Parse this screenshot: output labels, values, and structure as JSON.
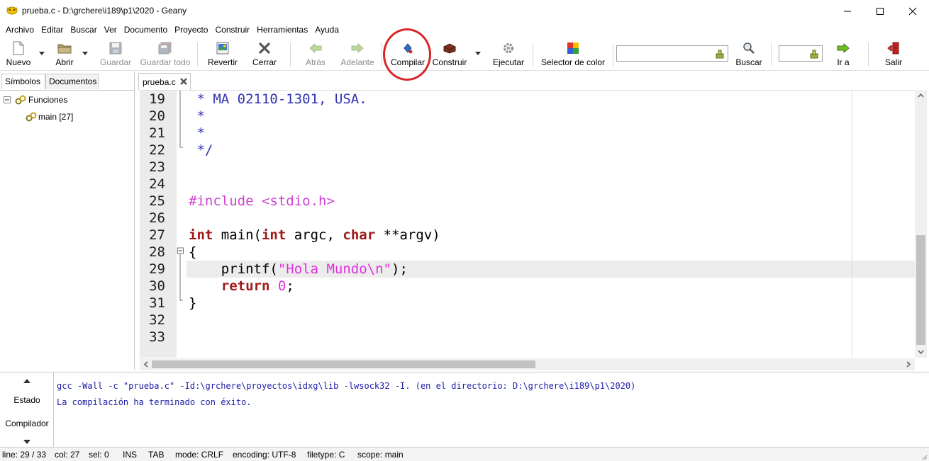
{
  "window": {
    "title": "prueba.c - D:\\grchere\\i189\\p1\\2020 - Geany",
    "icon": "geany-lamp-icon"
  },
  "menu": [
    "Archivo",
    "Editar",
    "Buscar",
    "Ver",
    "Documento",
    "Proyecto",
    "Construir",
    "Herramientas",
    "Ayuda"
  ],
  "toolbar": {
    "nuevo": "Nuevo",
    "abrir": "Abrir",
    "guardar": "Guardar",
    "guardar_todo": "Guardar todo",
    "revertir": "Revertir",
    "cerrar": "Cerrar",
    "atras": "Atrás",
    "adelante": "Adelante",
    "compilar": "Compilar",
    "construir": "Construir",
    "ejecutar": "Ejecutar",
    "selector_color": "Selector de color",
    "search_value": "",
    "buscar": "Buscar",
    "goto_value": "",
    "ir_a": "Ir a",
    "salir": "Salir",
    "highlight_color": "#d8262b"
  },
  "sidebar": {
    "tabs": [
      "Símbolos",
      "Documentos"
    ],
    "tree": {
      "group": "Funciones",
      "items": [
        "main [27]"
      ]
    }
  },
  "editor": {
    "tab_label": "prueba.c",
    "first_line": 19,
    "lines": [
      {
        "n": "19",
        "text": " * MA 02110-1301, USA."
      },
      {
        "n": "20",
        "text": " *"
      },
      {
        "n": "21",
        "text": " *"
      },
      {
        "n": "22",
        "text": " */"
      },
      {
        "n": "23",
        "text": ""
      },
      {
        "n": "24",
        "text": ""
      },
      {
        "n": "25",
        "text": "#include <stdio.h>"
      },
      {
        "n": "26",
        "text": ""
      },
      {
        "n": "27",
        "text": "int main(int argc, char **argv)"
      },
      {
        "n": "28",
        "text": "{"
      },
      {
        "n": "29",
        "text": "    printf(\"Hola Mundo\\n\");"
      },
      {
        "n": "30",
        "text": "    return 0;"
      },
      {
        "n": "31",
        "text": "}"
      },
      {
        "n": "32",
        "text": ""
      },
      {
        "n": "33",
        "text": ""
      }
    ],
    "current_line": 29
  },
  "messages": {
    "tabs": [
      "Estado",
      "Compilador"
    ],
    "lines": [
      "gcc -Wall -c \"prueba.c\" -Id:\\grchere\\proyectos\\idxg\\lib -lwsock32 -I. (en el directorio: D:\\grchere\\i189\\p1\\2020)",
      "La compilación ha terminado con éxito."
    ]
  },
  "status": {
    "line": "line: 29 / 33",
    "col": "col: 27",
    "sel": "sel: 0",
    "ins": "INS",
    "tab": "TAB",
    "mode": "mode: CRLF",
    "encoding": "encoding: UTF-8",
    "filetype": "filetype: C",
    "scope": "scope: main"
  }
}
